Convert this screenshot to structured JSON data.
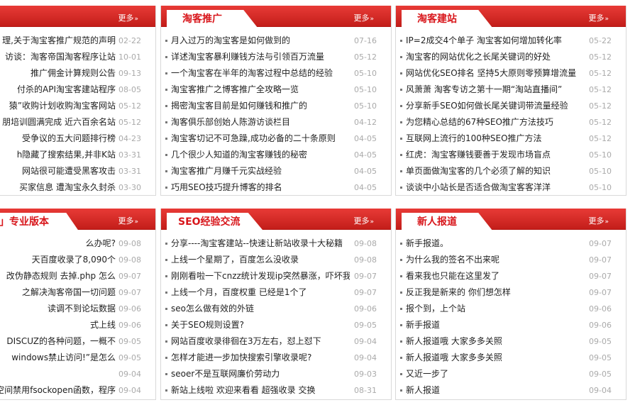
{
  "panels": [
    {
      "id": "p1",
      "title": "",
      "more": "更多",
      "items": [
        {
          "title": "理,关于淘宝客推广规范的声明",
          "date": "02-22"
        },
        {
          "title": "访谈：淘客帝国淘客程序让站",
          "date": "10-01"
        },
        {
          "title": "推广佣金计算规则公告",
          "date": "09-13"
        },
        {
          "title": "付杀的API淘宝客建站程序",
          "date": "08-05"
        },
        {
          "title": "猿”收购计划收购淘宝客网站",
          "date": "05-12"
        },
        {
          "title": "朋培训圆满完成 近六百余名站",
          "date": "05-12"
        },
        {
          "title": "受争议的五大问题排行榜",
          "date": "04-23"
        },
        {
          "title": "h隐藏了搜索结果,并非K站",
          "date": "03-31"
        },
        {
          "title": "网站很可能遭受黑客攻击",
          "date": "03-31"
        },
        {
          "title": "买家信息 遭淘宝永久封杀",
          "date": "03-30"
        }
      ]
    },
    {
      "id": "p2",
      "title": "淘客推广",
      "more": "更多",
      "items": [
        {
          "title": "月入过万的淘宝客是如何做到的",
          "date": "07-16"
        },
        {
          "title": "详述淘宝客暴利赚钱方法与引领百万流量",
          "date": "05-12"
        },
        {
          "title": "一个淘宝客在半年的淘客过程中总结的经验",
          "date": "05-10"
        },
        {
          "title": "淘宝客推广之博客推广全攻略一览",
          "date": "05-10"
        },
        {
          "title": "揭密淘宝客目前是如何赚钱和推广的",
          "date": "05-10"
        },
        {
          "title": "淘客俱乐部创始人陈游访谈栏目",
          "date": "04-12"
        },
        {
          "title": "淘宝客切记不可急躁,成功必备的二十条原则",
          "date": "04-05"
        },
        {
          "title": "几个很少人知道的淘宝客赚钱的秘密",
          "date": "04-05"
        },
        {
          "title": "淘宝客推广月赚千元实战经验",
          "date": "04-05"
        },
        {
          "title": "巧用SEO技巧提升博客的排名",
          "date": "04-05"
        }
      ]
    },
    {
      "id": "p3",
      "title": "淘客建站",
      "more": "更多",
      "items": [
        {
          "title": "IP=2成交4个单子 淘宝客如何增加转化率",
          "date": "05-22"
        },
        {
          "title": "淘宝客的网站优化之长尾关键词的好处",
          "date": "05-12"
        },
        {
          "title": "网站优化SEO排名 坚持5大原则零预算增流量",
          "date": "05-12"
        },
        {
          "title": "风萧萧 淘客专访之第十一期“淘站直播间”",
          "date": "05-12"
        },
        {
          "title": "分享新手SEO如何做长尾关键词带流量经验",
          "date": "05-12"
        },
        {
          "title": "为您精心总结的67种SEO推广方法技巧",
          "date": "05-12"
        },
        {
          "title": "互联网上流行的100种SEO推广方法",
          "date": "05-12"
        },
        {
          "title": "红虎：淘宝客赚钱要善于发现市场盲点",
          "date": "05-10"
        },
        {
          "title": "单页面做淘宝客的几个必须了解的知识",
          "date": "05-10"
        },
        {
          "title": "谈谈中小站长是否适合做淘宝客客洋洋",
          "date": "05-10"
        }
      ]
    },
    {
      "id": "p4",
      "title": "」专业版本",
      "more": "更多",
      "items": [
        {
          "title": "么办呢?",
          "date": "09-08"
        },
        {
          "title": "天百度收录了8,090个",
          "date": "09-08"
        },
        {
          "title": "改伪静态规则 去掉.php 怎么",
          "date": "09-07"
        },
        {
          "title": "之解决淘客帝国一切问题",
          "date": "09-07"
        },
        {
          "title": "读调不到论坛数据",
          "date": "09-06"
        },
        {
          "title": "式上线",
          "date": "09-06"
        },
        {
          "title": "DISCUZ的各种问题，一概不",
          "date": "09-05"
        },
        {
          "title": "windows禁止访问!”是怎么",
          "date": "09-05"
        },
        {
          "title": "",
          "date": "09-04"
        },
        {
          "title": "空间禁用fsockopen函数，程序",
          "date": "09-04"
        }
      ]
    },
    {
      "id": "p5",
      "title": "SEO经验交流",
      "more": "更多",
      "items": [
        {
          "title": "分享----淘宝客建站--快速让新站收录十大秘籍",
          "date": "09-08"
        },
        {
          "title": "上线一个星期了，百度怎么没收录",
          "date": "09-08"
        },
        {
          "title": "刚刚看啦一下cnzz统计发现ip突然暴涨，吓坏我",
          "date": "09-07"
        },
        {
          "title": "上线一个月，百度权重 已经是1个了",
          "date": "09-07"
        },
        {
          "title": "seo怎么做有效的外链",
          "date": "09-06"
        },
        {
          "title": "关于SEO规则设置?",
          "date": "09-05"
        },
        {
          "title": "网站百度收录徘徊在3万左右，怼上怼下",
          "date": "09-04"
        },
        {
          "title": "怎样才能进一步加快搜索引擎收录呢?",
          "date": "09-04"
        },
        {
          "title": "seoer不是互联网廉价劳动力",
          "date": "09-03"
        },
        {
          "title": "新站上线啦 欢迎来看看 超强收录 交换",
          "date": "08-31"
        }
      ]
    },
    {
      "id": "p6",
      "title": "新人报道",
      "more": "更多",
      "items": [
        {
          "title": "新手报道。",
          "date": "09-07"
        },
        {
          "title": "为什么我的签名不出来呢",
          "date": "09-07"
        },
        {
          "title": "看来我也只能在这里发了",
          "date": "09-07"
        },
        {
          "title": "反正我是新来的  你们想怎样",
          "date": "09-07"
        },
        {
          "title": "报个到，上个站",
          "date": "09-06"
        },
        {
          "title": "新手报道",
          "date": "09-06"
        },
        {
          "title": "新人报道哦 大家多多关照",
          "date": "09-05"
        },
        {
          "title": "新人报道哦 大家多多关照",
          "date": "09-05"
        },
        {
          "title": "又近一步了",
          "date": "09-05"
        },
        {
          "title": "新人报道",
          "date": "09-04"
        }
      ]
    }
  ]
}
